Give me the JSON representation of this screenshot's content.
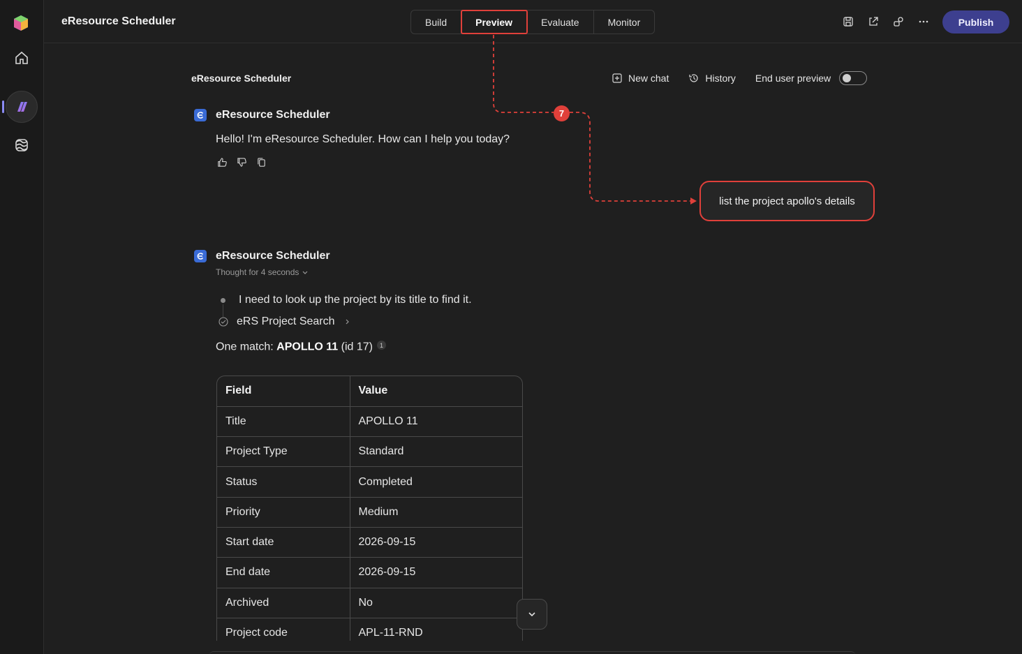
{
  "app": {
    "title": "eResource Scheduler"
  },
  "tabs": [
    {
      "label": "Build"
    },
    {
      "label": "Preview",
      "active": true
    },
    {
      "label": "Evaluate"
    },
    {
      "label": "Monitor"
    }
  ],
  "toolbar": {
    "icons": [
      "save-icon",
      "share-icon",
      "connect-icon",
      "more-icon"
    ],
    "publish_label": "Publish"
  },
  "chat": {
    "header_title": "eResource Scheduler",
    "new_chat_label": "New chat",
    "history_label": "History",
    "end_user_preview_label": "End user preview",
    "end_user_preview_on": false
  },
  "messages": {
    "greeting": {
      "bot_name": "eResource Scheduler",
      "text": "Hello! I'm eResource Scheduler. How can I help you today?"
    },
    "user": {
      "text": "list the project apollo's details"
    },
    "reply": {
      "bot_name": "eResource Scheduler",
      "thought": "Thought for 4 seconds",
      "step1": "I need to look up the project by its title to find it.",
      "step2": "eRS Project Search",
      "match_prefix": "One match: ",
      "match_name": "APOLLO 11",
      "match_suffix": " (id 17)",
      "citation": "1"
    }
  },
  "table": {
    "headers": [
      "Field",
      "Value"
    ],
    "rows": [
      [
        "Title",
        "APOLLO 11"
      ],
      [
        "Project Type",
        "Standard"
      ],
      [
        "Status",
        "Completed"
      ],
      [
        "Priority",
        "Medium"
      ],
      [
        "Start date",
        "2026-09-15"
      ],
      [
        "End date",
        "2026-09-15"
      ],
      [
        "Archived",
        "No"
      ],
      [
        "Project code",
        "APL-11-RND"
      ]
    ]
  },
  "annotation": {
    "step": "7",
    "color": "#e0403a"
  },
  "colors": {
    "accent": "#3d3f8f",
    "annotation": "#e0403a",
    "background": "#1f1f1f"
  }
}
